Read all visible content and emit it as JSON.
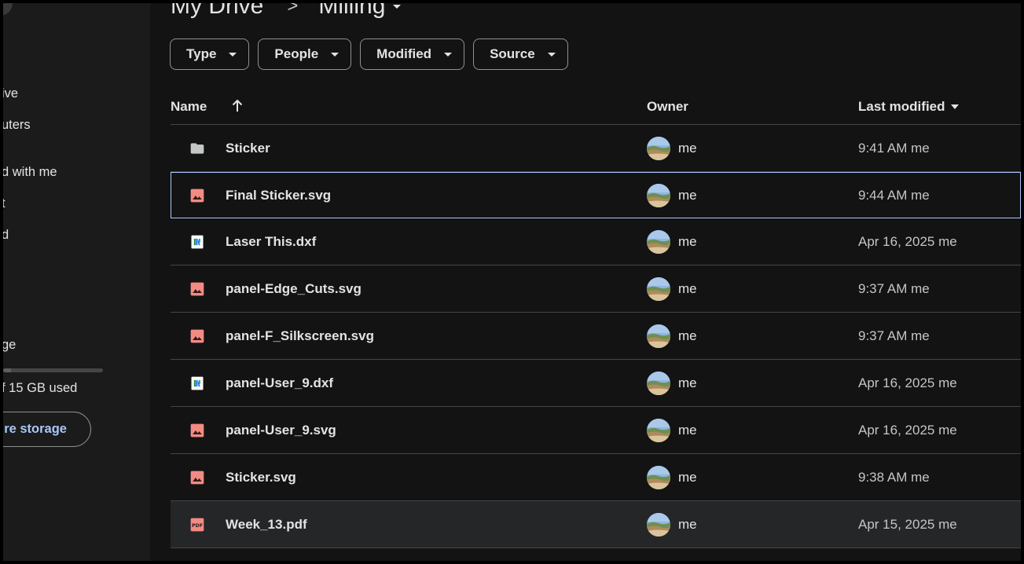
{
  "sidebar": {
    "items": [
      {
        "label": "ive"
      },
      {
        "label": "uters"
      },
      {
        "label": "d with me"
      },
      {
        "label": "t"
      },
      {
        "label": "d"
      },
      {
        "label": "ge"
      }
    ],
    "storage": {
      "used_text": "f 15 GB used",
      "fraction_used": 0.08,
      "button_label": "re storage"
    }
  },
  "breadcrumb": {
    "parent": "My Drive",
    "separator": ">",
    "current": "Milling"
  },
  "filters": [
    {
      "label": "Type"
    },
    {
      "label": "People"
    },
    {
      "label": "Modified"
    },
    {
      "label": "Source"
    }
  ],
  "columns": {
    "name": "Name",
    "owner": "Owner",
    "modified": "Last modified"
  },
  "files": [
    {
      "name": "Sticker",
      "icon": "folder-icon",
      "owner": "me",
      "modified": "9:41 AM me"
    },
    {
      "name": "Final Sticker.svg",
      "icon": "image-icon",
      "owner": "me",
      "modified": "9:44 AM me"
    },
    {
      "name": "Laser This.dxf",
      "icon": "drawing-file-icon",
      "owner": "me",
      "modified": "Apr 16, 2025 me"
    },
    {
      "name": "panel-Edge_Cuts.svg",
      "icon": "image-icon",
      "owner": "me",
      "modified": "9:37 AM me"
    },
    {
      "name": "panel-F_Silkscreen.svg",
      "icon": "image-icon",
      "owner": "me",
      "modified": "9:37 AM me"
    },
    {
      "name": "panel-User_9.dxf",
      "icon": "drawing-file-icon",
      "owner": "me",
      "modified": "Apr 16, 2025 me"
    },
    {
      "name": "panel-User_9.svg",
      "icon": "image-icon",
      "owner": "me",
      "modified": "Apr 16, 2025 me"
    },
    {
      "name": "Sticker.svg",
      "icon": "image-icon",
      "owner": "me",
      "modified": "9:38 AM me"
    },
    {
      "name": "Week_13.pdf",
      "icon": "pdf-icon",
      "owner": "me",
      "modified": "Apr 15, 2025 me"
    }
  ],
  "colors": {
    "background": "#131314",
    "sidebar": "#1b1b1b",
    "text": "#e3e3e3",
    "selected_border": "#a8c7fa",
    "image_icon": "#f28b82",
    "divider": "#444746"
  }
}
